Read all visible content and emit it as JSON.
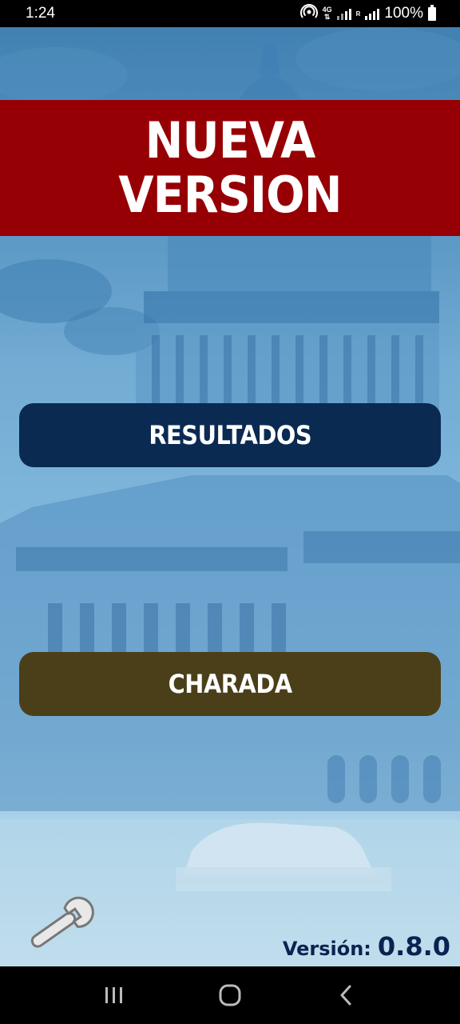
{
  "status_bar": {
    "time": "1:24",
    "network_type": "4G",
    "roaming": "R",
    "battery": "100%"
  },
  "banner": {
    "title": "NUEVA VERSION"
  },
  "buttons": {
    "resultados": "RESULTADOS",
    "charada": "CHARADA"
  },
  "footer": {
    "version_label": "Versión:",
    "version_value": "0.8.0"
  },
  "icons": {
    "settings": "wrench-icon",
    "hotspot": "hotspot-icon",
    "recents": "recents-icon",
    "home": "home-icon",
    "back": "back-icon"
  },
  "colors": {
    "banner": "#960005",
    "resultados_button": "#0a2a52",
    "charada_button": "#4b3f1a",
    "version_text": "#0a2250"
  }
}
